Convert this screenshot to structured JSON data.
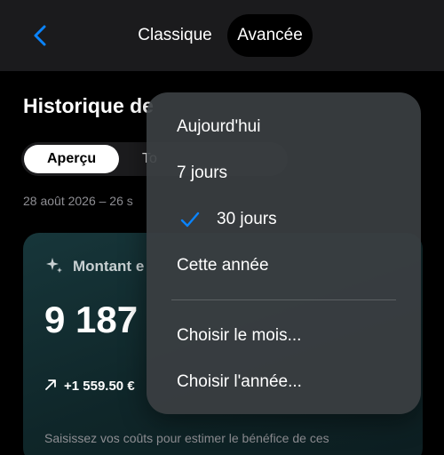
{
  "header": {
    "mode_classic": "Classique",
    "mode_advanced": "Avancée"
  },
  "page": {
    "title": "Historique de",
    "tabs": [
      "Aperçu",
      "To"
    ],
    "date_range": "28 août 2026 – 26 s"
  },
  "card": {
    "label": "Montant e",
    "value": "9 187",
    "trend": "+1 559.50 €",
    "hint": "Saisissez vos coûts pour estimer le bénéfice de ces courses"
  },
  "menu": {
    "items": [
      "Aujourd'hui",
      "7 jours",
      "30 jours",
      "Cette année",
      "Choisir le mois...",
      "Choisir l'année..."
    ],
    "selected": "30 jours"
  },
  "colors": {
    "accent": "#0a84ff",
    "background": "#000000",
    "topbar": "#1b1b1d",
    "card": "#17363a"
  },
  "icons": [
    "back-chevron-icon",
    "sparkle-icon",
    "arrow-up-right-icon",
    "checkmark-icon"
  ]
}
